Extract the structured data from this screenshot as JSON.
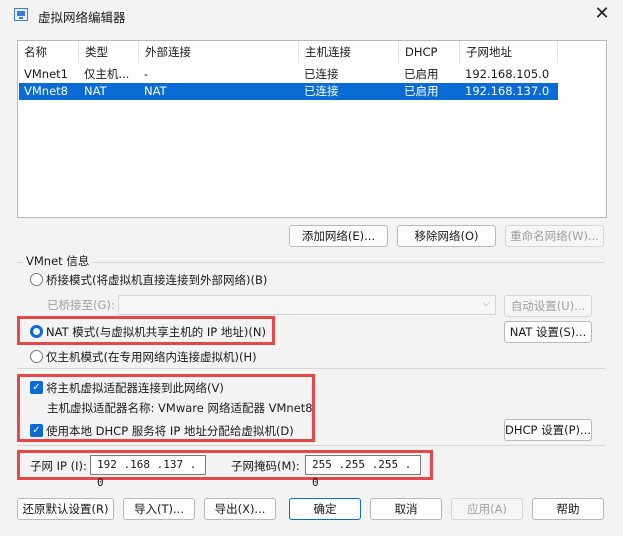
{
  "window": {
    "title": "虚拟网络编辑器",
    "close_glyph": "✕"
  },
  "table": {
    "headers": [
      "名称",
      "类型",
      "外部连接",
      "主机连接",
      "DHCP",
      "子网地址"
    ],
    "rows": [
      [
        "VMnet1",
        "仅主机...",
        "-",
        "已连接",
        "已启用",
        "192.168.105.0"
      ],
      [
        "VMnet8",
        "NAT",
        "NAT",
        "已连接",
        "已启用",
        "192.168.137.0"
      ]
    ],
    "selected_index": 1
  },
  "list_buttons": {
    "add": "添加网络(E)...",
    "remove": "移除网络(O)",
    "rename": "重命名网络(W)..."
  },
  "vmnet_info": {
    "group_label": "VMnet 信息",
    "bridged_label": "桥接模式(将虚拟机直接连接到外部网络)(B)",
    "bridged_to_label": "已桥接至(G):",
    "auto_settings": "自动设置(U)...",
    "nat_label": "NAT 模式(与虚拟机共享主机的 IP 地址)(N)",
    "nat_settings": "NAT 设置(S)...",
    "hostonly_label": "仅主机模式(在专用网络内连接虚拟机)(H)",
    "connect_adapter_label": "将主机虚拟适配器连接到此网络(V)",
    "adapter_name_label": "主机虚拟适配器名称: VMware 网络适配器 VMnet8",
    "use_dhcp_label": "使用本地 DHCP 服务将 IP 地址分配给虚拟机(D)",
    "dhcp_settings": "DHCP 设置(P)...",
    "subnet_ip_label": "子网 IP (I):",
    "subnet_ip_value": "192 .168 .137 . 0",
    "subnet_mask_label": "子网掩码(M):",
    "subnet_mask_value": "255 .255 .255 . 0"
  },
  "footer": {
    "restore": "还原默认设置(R)",
    "import": "导入(T)...",
    "export": "导出(X)...",
    "ok": "确定",
    "cancel": "取消",
    "apply": "应用(A)",
    "help": "帮助"
  },
  "colors": {
    "accent": "#0a6bd4",
    "highlight_box": "#e64848",
    "window_bg": "#f3f3f3"
  }
}
